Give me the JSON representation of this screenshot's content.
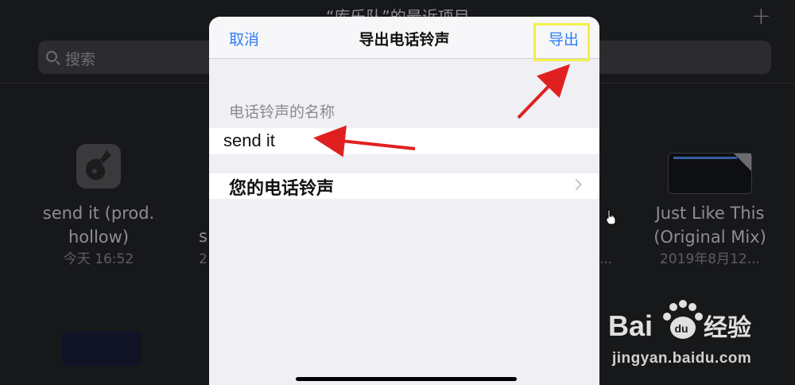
{
  "background": {
    "header_title": "“库乐队”的最近项目",
    "search_placeholder": "搜索",
    "files": [
      {
        "name_line1": "send it (prod.",
        "name_line2": "hollow)",
        "date": "今天 16:52"
      },
      {
        "name_line1": "Just Like This",
        "name_line2": "(Original Mix)",
        "date": "2019年8月12..."
      }
    ],
    "peek_tile_left": {
      "name": "s",
      "date": "2"
    },
    "peek_tile_right": {
      "date": "..."
    }
  },
  "sheet": {
    "cancel_label": "取消",
    "title": "导出电话铃声",
    "export_label": "导出",
    "section_label": "电话铃声的名称",
    "ringtone_name_value": "send it",
    "your_ringtones_label": "您的电话铃声"
  },
  "watermark": {
    "brand_prefix": "Bai",
    "brand_suffix": "经验",
    "url": "jingyan.baidu.com"
  },
  "colors": {
    "accent_blue": "#2f7cf6",
    "annotation_red": "#e02020",
    "highlight_yellow": "#f1f04a"
  }
}
